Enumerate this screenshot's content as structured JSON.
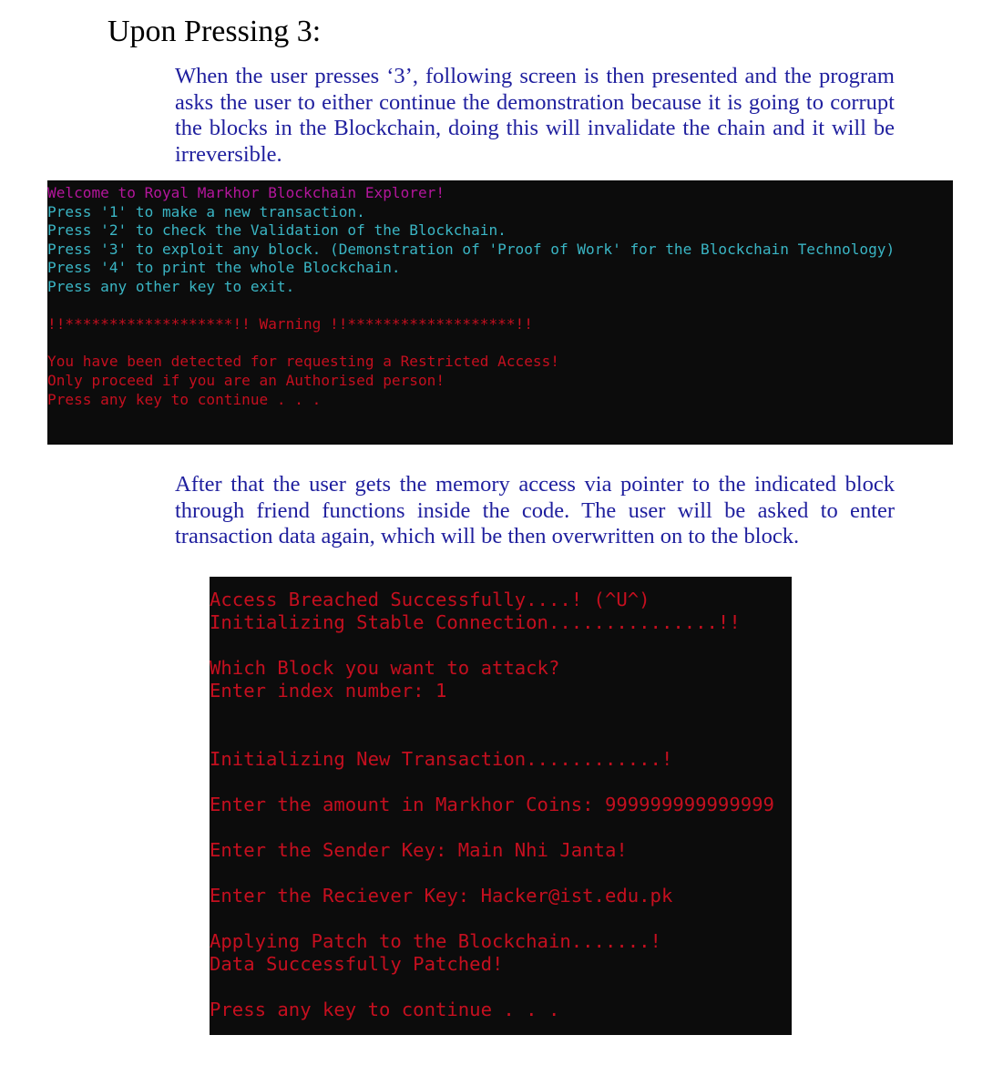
{
  "heading": "Upon Pressing 3:",
  "paragraph1": "When the user presses ‘3’, following screen is then presented and the program asks the user to either continue the demonstration because it is going to corrupt the blocks in the Blockchain, doing this will invalidate the chain and it will be irreversible.",
  "paragraph2": "After that the user gets the memory access via pointer to the indicated block through friend functions inside the code. The user will be asked to enter transaction data again, which will be then overwritten on to the block.",
  "colors": {
    "paragraph_text": "#1f1f9e",
    "console_bg": "#0c0c0c",
    "welcome_magenta": "#b4169c",
    "menu_cyan": "#39b8c8",
    "warning_red": "#c50f1f"
  },
  "console1": {
    "lines": [
      {
        "text": "Welcome to Royal Markhor Blockchain Explorer!",
        "color": "#b4169c"
      },
      {
        "text": "Press '1' to make a new transaction.",
        "color": "#3ab5c4"
      },
      {
        "text": "Press '2' to check the Validation of the Blockchain.",
        "color": "#3ab5c4"
      },
      {
        "text": "Press '3' to exploit any block. (Demonstration of 'Proof of Work' for the Blockchain Technology)",
        "color": "#3ab5c4"
      },
      {
        "text": "Press '4' to print the whole Blockchain.",
        "color": "#3ab5c4"
      },
      {
        "text": "Press any other key to exit.",
        "color": "#3ab5c4"
      },
      {
        "text": "",
        "color": "#c50f1f"
      },
      {
        "text": "!!*******************!! Warning !!*******************!!",
        "color": "#c50f1f"
      },
      {
        "text": "",
        "color": "#c50f1f"
      },
      {
        "text": "You have been detected for requesting a Restricted Access!",
        "color": "#c50f1f"
      },
      {
        "text": "Only proceed if you are an Authorised person!",
        "color": "#c50f1f"
      },
      {
        "text": "Press any key to continue . . .",
        "color": "#c50f1f"
      }
    ]
  },
  "console2": {
    "lines": [
      {
        "text": "Access Breached Successfully....! (^U^)",
        "color": "#c50f1f"
      },
      {
        "text": "Initializing Stable Connection...............!!",
        "color": "#c50f1f"
      },
      {
        "text": "",
        "color": "#c50f1f"
      },
      {
        "text": "Which Block you want to attack?",
        "color": "#c50f1f"
      },
      {
        "text": "Enter index number: 1",
        "color": "#c50f1f"
      },
      {
        "text": "",
        "color": "#c50f1f"
      },
      {
        "text": "",
        "color": "#c50f1f"
      },
      {
        "text": "Initializing New Transaction............!",
        "color": "#c50f1f"
      },
      {
        "text": "",
        "color": "#c50f1f"
      },
      {
        "text": "Enter the amount in Markhor Coins: 999999999999999",
        "color": "#c50f1f"
      },
      {
        "text": "",
        "color": "#c50f1f"
      },
      {
        "text": "Enter the Sender Key: Main Nhi Janta!",
        "color": "#c50f1f"
      },
      {
        "text": "",
        "color": "#c50f1f"
      },
      {
        "text": "Enter the Reciever Key: Hacker@ist.edu.pk",
        "color": "#c50f1f"
      },
      {
        "text": "",
        "color": "#c50f1f"
      },
      {
        "text": "Applying Patch to the Blockchain.......!",
        "color": "#c50f1f"
      },
      {
        "text": "Data Successfully Patched!",
        "color": "#c50f1f"
      },
      {
        "text": "",
        "color": "#c50f1f"
      },
      {
        "text": "Press any key to continue . . .",
        "color": "#c50f1f"
      }
    ]
  }
}
